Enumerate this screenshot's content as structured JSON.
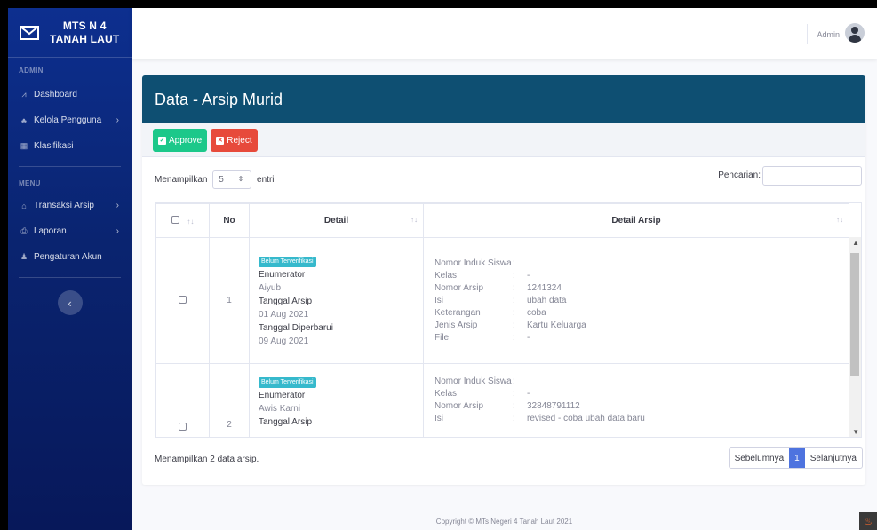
{
  "brand": {
    "line1": "MTS N 4",
    "line2": "TANAH LAUT"
  },
  "sidebar": {
    "admin_heading": "ADMIN",
    "admin_items": [
      {
        "label": "Dashboard",
        "icon": "chart-icon"
      },
      {
        "label": "Kelola Pengguna",
        "icon": "users-icon"
      },
      {
        "label": "Klasifikasi",
        "icon": "table-icon"
      }
    ],
    "menu_heading": "MENU",
    "menu_items": [
      {
        "label": "Transaksi Arsip",
        "icon": "bank-icon"
      },
      {
        "label": "Laporan",
        "icon": "print-icon"
      },
      {
        "label": "Pengaturan Akun",
        "icon": "user-icon"
      }
    ],
    "toggle_glyph": "‹"
  },
  "topbar": {
    "user_name": "Admin"
  },
  "card": {
    "title": "Data - Arsip Murid",
    "approve_label": "Approve",
    "reject_label": "Reject",
    "show_prefix": "Menampilkan",
    "show_value": "5",
    "show_suffix": "entri",
    "search_label": "Pencarian:"
  },
  "table": {
    "headers": {
      "no": "No",
      "detail": "Detail",
      "detail_arsip": "Detail Arsip"
    },
    "rows": [
      {
        "no": "1",
        "badge": "Belum Terverifikasi",
        "enumerator_label": "Enumerator",
        "enumerator": "Aiyub",
        "tanggal_arsip_label": "Tanggal Arsip",
        "tanggal_arsip": "01 Aug 2021",
        "tanggal_diperbarui_label": "Tanggal Diperbarui",
        "tanggal_diperbarui": "09 Aug 2021",
        "arsip": {
          "nis_label": "Nomor Induk Siswa",
          "nis": "",
          "kelas_label": "Kelas",
          "kelas": "-",
          "nomor_label": "Nomor Arsip",
          "nomor": "1241324",
          "isi_label": "Isi",
          "isi": "ubah data",
          "keterangan_label": "Keterangan",
          "keterangan": "coba",
          "jenis_label": "Jenis Arsip",
          "jenis": "Kartu Keluarga",
          "file_label": "File",
          "file": "-"
        }
      },
      {
        "no": "2",
        "badge": "Belum Terverifikasi",
        "enumerator_label": "Enumerator",
        "enumerator": "Awis Karni",
        "tanggal_arsip_label": "Tanggal Arsip",
        "arsip": {
          "nis_label": "Nomor Induk Siswa",
          "nis": "",
          "kelas_label": "Kelas",
          "kelas": "-",
          "nomor_label": "Nomor Arsip",
          "nomor": "32848791112",
          "isi_label": "Isi",
          "isi": "revised - coba ubah data baru"
        }
      }
    ]
  },
  "info": "Menampilkan 2 data arsip.",
  "pagination": {
    "prev": "Sebelumnya",
    "current": "1",
    "next": "Selanjutnya"
  },
  "footer": "Copyright © MTs Negeri 4 Tanah Laut 2021"
}
